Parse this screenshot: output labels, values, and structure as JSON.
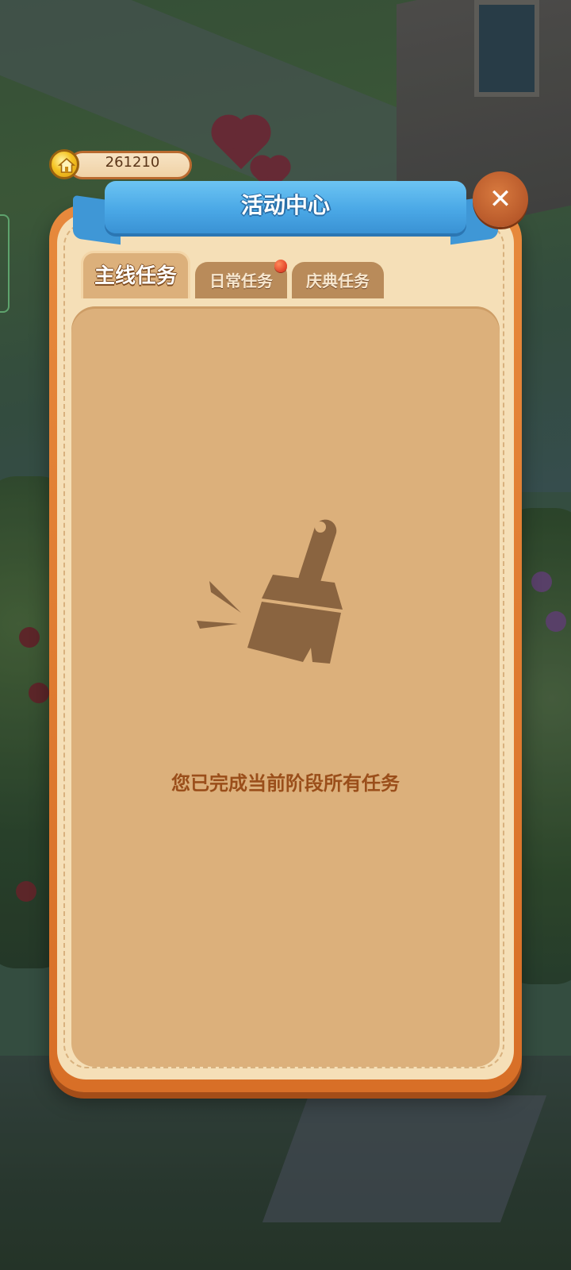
{
  "currency": {
    "value": "261210",
    "icon": "house-coin-icon"
  },
  "panel": {
    "title": "活动中心",
    "close_icon": "close-icon",
    "close_glyph": "✕"
  },
  "tabs": [
    {
      "label": "主线任务",
      "selected": true
    },
    {
      "label": "日常任务",
      "selected": false,
      "has_notification": true
    },
    {
      "label": "庆典任务",
      "selected": false
    }
  ],
  "empty_state": {
    "icon": "broom-icon",
    "message": "您已完成当前阶段所有任务"
  },
  "colors": {
    "panel_frame": "#d86f27",
    "panel_fill": "#f5dfb7",
    "content_fill": "#dcb07b",
    "banner_blue": "#4aa8e6",
    "message_text": "#9a4e1a",
    "icon_brown": "#8a6440"
  }
}
